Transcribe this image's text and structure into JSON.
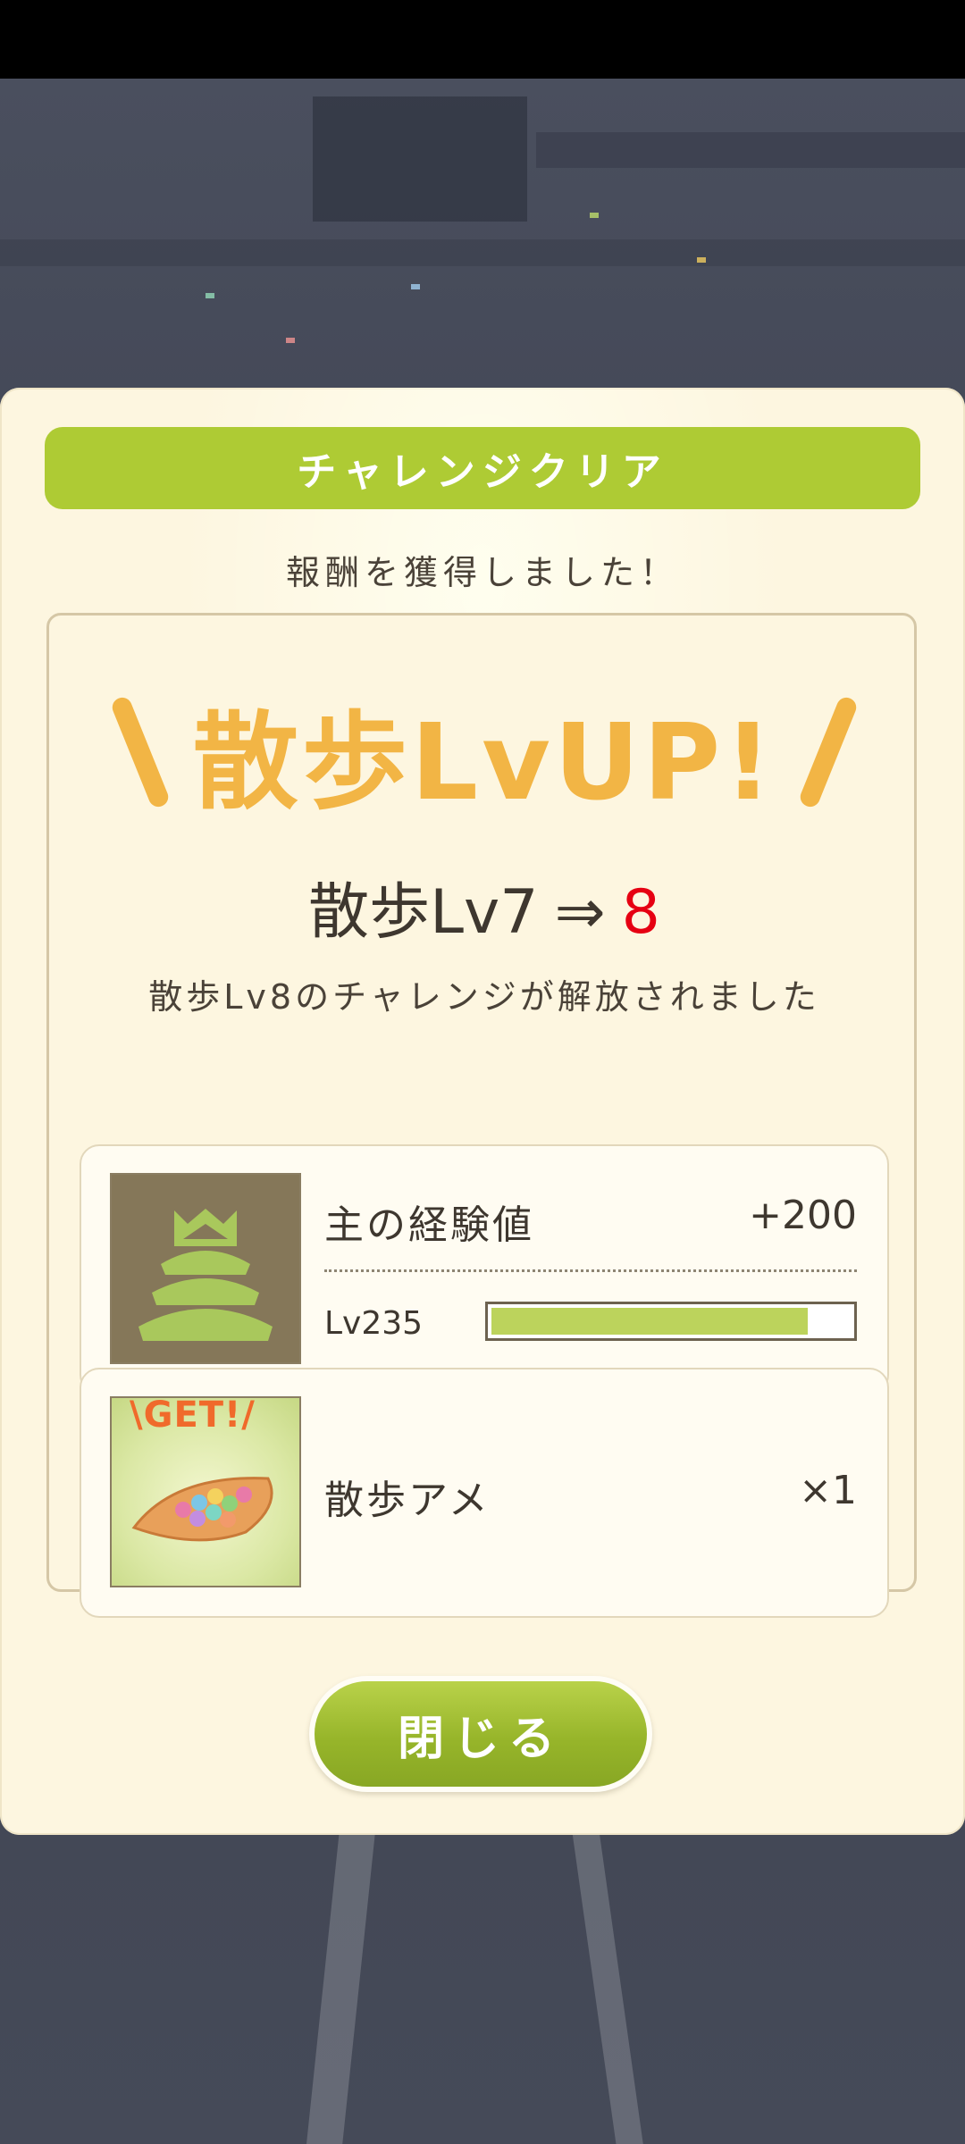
{
  "dialog": {
    "title": "チャレンジクリア",
    "subtitle": "報酬を獲得しました！",
    "levelup_text": "散歩LvUP!",
    "level_change": {
      "from": "散歩Lv7",
      "arrow": "⇒",
      "to": "8"
    },
    "unlock_message": "散歩Lv8のチャレンジが解放されました",
    "rewards": [
      {
        "label": "主の経験値",
        "value": "+200",
        "level": "Lv235",
        "progress": 0.88,
        "icon": "castle-icon"
      },
      {
        "badge": "\\GET!/",
        "label": "散歩アメ",
        "value": "×1",
        "icon": "candy-leaf-icon"
      }
    ],
    "close_label": "閉じる"
  },
  "colors": {
    "accent_green": "#aecb34",
    "levelup_orange": "#f2b545",
    "highlight_red": "#e60012",
    "panel_bg": "#fdf6e0"
  }
}
